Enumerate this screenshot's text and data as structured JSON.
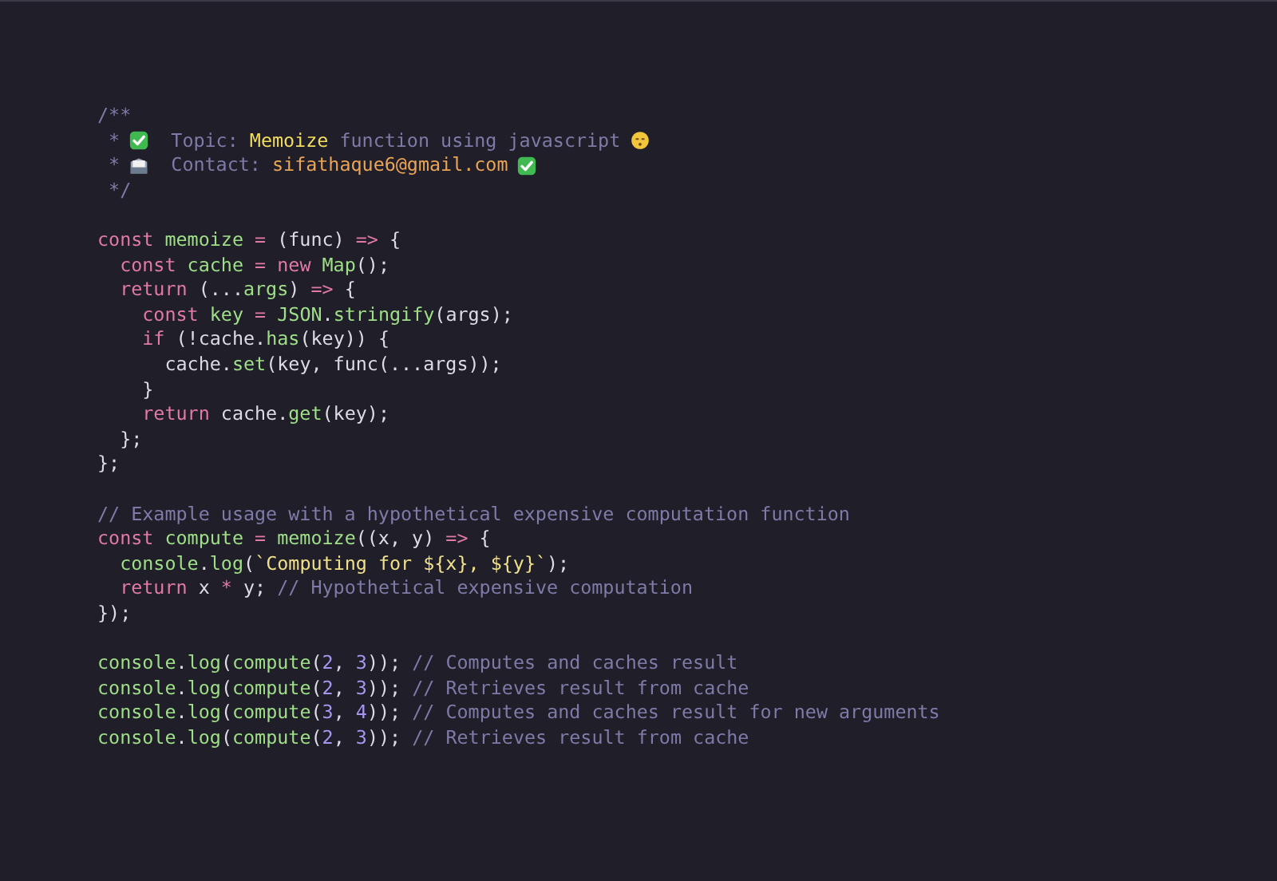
{
  "code_blocks": [
    [
      {
        "tokens": [
          {
            "kind": "comment",
            "t": "/**"
          }
        ]
      },
      {
        "tokens": [
          {
            "kind": "comment",
            "t": " *"
          },
          {
            "kind": "check"
          },
          {
            "kind": "comment",
            "t": "  Topic:"
          },
          {
            "kind": "highlight",
            "t": " Memoize"
          },
          {
            "kind": "comment",
            "t": " function using javascript"
          },
          {
            "kind": "face"
          }
        ]
      },
      {
        "tokens": [
          {
            "kind": "comment",
            "t": " *"
          },
          {
            "kind": "mail"
          },
          {
            "kind": "comment",
            "t": "  Contact:"
          },
          {
            "kind": "email",
            "t": " sifathaque6@gmail.com"
          },
          {
            "kind": "check"
          }
        ]
      },
      {
        "tokens": [
          {
            "kind": "comment",
            "t": " */"
          }
        ]
      }
    ],
    [
      {
        "tokens": [
          {
            "kind": "keyword",
            "t": "const"
          },
          {
            "kind": "function",
            "t": " memoize"
          },
          {
            "kind": "keyword",
            "t": " ="
          },
          {
            "kind": "plain",
            "t": " (func) "
          },
          {
            "kind": "keyword",
            "t": "=>"
          },
          {
            "kind": "plain",
            "t": " {"
          }
        ]
      },
      {
        "tokens": [
          {
            "kind": "keyword",
            "t": "  const"
          },
          {
            "kind": "function",
            "t": " cache"
          },
          {
            "kind": "keyword",
            "t": " ="
          },
          {
            "kind": "keyword",
            "t": " new"
          },
          {
            "kind": "function",
            "t": " Map"
          },
          {
            "kind": "plain",
            "t": "();"
          }
        ]
      },
      {
        "tokens": [
          {
            "kind": "keyword",
            "t": "  return"
          },
          {
            "kind": "plain",
            "t": " (..."
          },
          {
            "kind": "function",
            "t": "args"
          },
          {
            "kind": "plain",
            "t": ") "
          },
          {
            "kind": "keyword",
            "t": "=>"
          },
          {
            "kind": "plain",
            "t": " {"
          }
        ]
      },
      {
        "tokens": [
          {
            "kind": "keyword",
            "t": "    const"
          },
          {
            "kind": "function",
            "t": " key"
          },
          {
            "kind": "keyword",
            "t": " ="
          },
          {
            "kind": "function",
            "t": " JSON"
          },
          {
            "kind": "plain",
            "t": "."
          },
          {
            "kind": "function",
            "t": "stringify"
          },
          {
            "kind": "plain",
            "t": "(args);"
          }
        ]
      },
      {
        "tokens": [
          {
            "kind": "keyword",
            "t": "    if"
          },
          {
            "kind": "plain",
            "t": " (!cache."
          },
          {
            "kind": "function",
            "t": "has"
          },
          {
            "kind": "plain",
            "t": "(key)) {"
          }
        ]
      },
      {
        "tokens": [
          {
            "kind": "plain",
            "t": "      cache."
          },
          {
            "kind": "function",
            "t": "set"
          },
          {
            "kind": "plain",
            "t": "(key, func(...args));"
          }
        ]
      },
      {
        "tokens": [
          {
            "kind": "plain",
            "t": "    }"
          }
        ]
      },
      {
        "tokens": [
          {
            "kind": "keyword",
            "t": "    return"
          },
          {
            "kind": "plain",
            "t": " cache."
          },
          {
            "kind": "function",
            "t": "get"
          },
          {
            "kind": "plain",
            "t": "(key);"
          }
        ]
      },
      {
        "tokens": [
          {
            "kind": "plain",
            "t": "  };"
          }
        ]
      },
      {
        "tokens": [
          {
            "kind": "plain",
            "t": "};"
          }
        ]
      }
    ],
    [
      {
        "tokens": [
          {
            "kind": "comment",
            "t": "// Example usage with a hypothetical expensive computation function"
          }
        ]
      },
      {
        "tokens": [
          {
            "kind": "keyword",
            "t": "const"
          },
          {
            "kind": "function",
            "t": " compute"
          },
          {
            "kind": "keyword",
            "t": " ="
          },
          {
            "kind": "function",
            "t": " memoize"
          },
          {
            "kind": "plain",
            "t": "((x, y) "
          },
          {
            "kind": "keyword",
            "t": "=>"
          },
          {
            "kind": "plain",
            "t": " {"
          }
        ]
      },
      {
        "tokens": [
          {
            "kind": "function",
            "t": "  console"
          },
          {
            "kind": "plain",
            "t": "."
          },
          {
            "kind": "function",
            "t": "log"
          },
          {
            "kind": "plain",
            "t": "("
          },
          {
            "kind": "string",
            "t": "`Computing for ${x}, ${y}`"
          },
          {
            "kind": "plain",
            "t": ");"
          }
        ]
      },
      {
        "tokens": [
          {
            "kind": "keyword",
            "t": "  return"
          },
          {
            "kind": "plain",
            "t": " x "
          },
          {
            "kind": "keyword",
            "t": "*"
          },
          {
            "kind": "plain",
            "t": " y; "
          },
          {
            "kind": "comment",
            "t": "// Hypothetical expensive computation"
          }
        ]
      },
      {
        "tokens": [
          {
            "kind": "plain",
            "t": "});"
          }
        ]
      }
    ],
    [
      {
        "tokens": [
          {
            "kind": "function",
            "t": "console"
          },
          {
            "kind": "plain",
            "t": "."
          },
          {
            "kind": "function",
            "t": "log"
          },
          {
            "kind": "plain",
            "t": "("
          },
          {
            "kind": "function",
            "t": "compute"
          },
          {
            "kind": "plain",
            "t": "("
          },
          {
            "kind": "number",
            "t": "2"
          },
          {
            "kind": "plain",
            "t": ", "
          },
          {
            "kind": "number",
            "t": "3"
          },
          {
            "kind": "plain",
            "t": ")); "
          },
          {
            "kind": "comment",
            "t": "// Computes and caches result"
          }
        ]
      },
      {
        "tokens": [
          {
            "kind": "function",
            "t": "console"
          },
          {
            "kind": "plain",
            "t": "."
          },
          {
            "kind": "function",
            "t": "log"
          },
          {
            "kind": "plain",
            "t": "("
          },
          {
            "kind": "function",
            "t": "compute"
          },
          {
            "kind": "plain",
            "t": "("
          },
          {
            "kind": "number",
            "t": "2"
          },
          {
            "kind": "plain",
            "t": ", "
          },
          {
            "kind": "number",
            "t": "3"
          },
          {
            "kind": "plain",
            "t": ")); "
          },
          {
            "kind": "comment",
            "t": "// Retrieves result from cache"
          }
        ]
      },
      {
        "tokens": [
          {
            "kind": "function",
            "t": "console"
          },
          {
            "kind": "plain",
            "t": "."
          },
          {
            "kind": "function",
            "t": "log"
          },
          {
            "kind": "plain",
            "t": "("
          },
          {
            "kind": "function",
            "t": "compute"
          },
          {
            "kind": "plain",
            "t": "("
          },
          {
            "kind": "number",
            "t": "3"
          },
          {
            "kind": "plain",
            "t": ", "
          },
          {
            "kind": "number",
            "t": "4"
          },
          {
            "kind": "plain",
            "t": ")); "
          },
          {
            "kind": "comment",
            "t": "// Computes and caches result for new arguments"
          }
        ]
      },
      {
        "tokens": [
          {
            "kind": "function",
            "t": "console"
          },
          {
            "kind": "plain",
            "t": "."
          },
          {
            "kind": "function",
            "t": "log"
          },
          {
            "kind": "plain",
            "t": "("
          },
          {
            "kind": "function",
            "t": "compute"
          },
          {
            "kind": "plain",
            "t": "("
          },
          {
            "kind": "number",
            "t": "2"
          },
          {
            "kind": "plain",
            "t": ", "
          },
          {
            "kind": "number",
            "t": "3"
          },
          {
            "kind": "plain",
            "t": ")); "
          },
          {
            "kind": "comment",
            "t": "// Retrieves result from cache"
          }
        ]
      }
    ]
  ]
}
